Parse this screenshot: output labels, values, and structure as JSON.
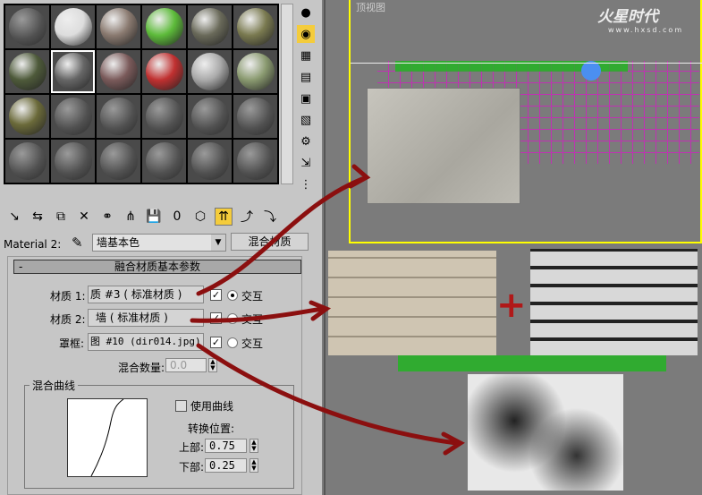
{
  "material_editor": {
    "material_label": "Material 2:",
    "material_name": "墙基本色",
    "material_type_button": "混合材质",
    "rollout_title": "融合材质基本参数",
    "rollout_toggle": "-",
    "rows": [
      {
        "label": "材质 1:",
        "value": "质 #3  ( 标准材质 )",
        "checked": true,
        "radio_selected": true,
        "radio_label": "交互"
      },
      {
        "label": "材质 2:",
        "value": "墙   ( 标准材质 )",
        "checked": true,
        "radio_selected": false,
        "radio_label": "交互"
      },
      {
        "label": "罩框:",
        "value": "图 #10 (dir014.jpg)",
        "checked": true,
        "radio_selected": false,
        "radio_label": "交互"
      }
    ],
    "mix_amount_label": "混合数量:",
    "mix_amount_value": "0.0",
    "curve_group_title": "混合曲线",
    "use_curve_label": "使用曲线",
    "use_curve_checked": false,
    "transition_label": "转换位置:",
    "upper_label": "上部:",
    "upper_value": "0.75",
    "lower_label": "下部:",
    "lower_value": "0.25"
  },
  "viewport": {
    "top_label": "顶视图"
  },
  "watermark": {
    "brand": "火星时代",
    "url": "www.hxsd.com"
  },
  "overlay": {
    "plus": "+"
  },
  "colors": {
    "panel": "#c6c6c6",
    "viewport": "#7b7b7b",
    "active_border": "#ffff00",
    "arrow": "#8b0f0f"
  }
}
